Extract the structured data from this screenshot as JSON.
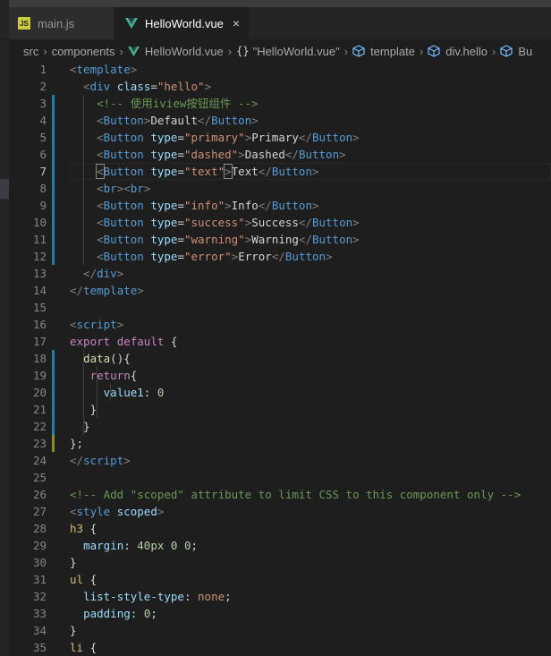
{
  "tabs": [
    {
      "label": "main.js",
      "icon": "js-file-icon",
      "active": false
    },
    {
      "label": "HelloWorld.vue",
      "icon": "vue-file-icon",
      "active": true,
      "close": "×"
    }
  ],
  "breadcrumb": {
    "items": [
      "src",
      "components",
      "HelloWorld.vue",
      "\"HelloWorld.vue\"",
      "template",
      "div.hello",
      "Bu"
    ]
  },
  "editor": {
    "current_line": 7,
    "lines": [
      {
        "n": "1",
        "tokens": [
          [
            "t-punct",
            "<"
          ],
          [
            "t-tag",
            "template"
          ],
          [
            "t-punct",
            ">"
          ]
        ]
      },
      {
        "n": "2",
        "tokens": [
          [
            "t-plain",
            "  "
          ],
          [
            "t-punct",
            "<"
          ],
          [
            "t-tag",
            "div"
          ],
          [
            "t-plain",
            " "
          ],
          [
            "t-attr",
            "class"
          ],
          [
            "t-plain",
            "="
          ],
          [
            "t-str",
            "\"hello\""
          ],
          [
            "t-punct",
            ">"
          ]
        ]
      },
      {
        "n": "3",
        "tokens": [
          [
            "t-plain",
            "    "
          ],
          [
            "t-com",
            "<!-- 使用iview按钮组件 -->"
          ]
        ]
      },
      {
        "n": "4",
        "tokens": [
          [
            "t-plain",
            "    "
          ],
          [
            "t-punct",
            "<"
          ],
          [
            "t-tag",
            "Button"
          ],
          [
            "t-punct",
            ">"
          ],
          [
            "t-text",
            "Default"
          ],
          [
            "t-punct",
            "</"
          ],
          [
            "t-tag",
            "Button"
          ],
          [
            "t-punct",
            ">"
          ]
        ]
      },
      {
        "n": "5",
        "tokens": [
          [
            "t-plain",
            "    "
          ],
          [
            "t-punct",
            "<"
          ],
          [
            "t-tag",
            "Button"
          ],
          [
            "t-plain",
            " "
          ],
          [
            "t-attr",
            "type"
          ],
          [
            "t-plain",
            "="
          ],
          [
            "t-str",
            "\"primary\""
          ],
          [
            "t-punct",
            ">"
          ],
          [
            "t-text",
            "Primary"
          ],
          [
            "t-punct",
            "</"
          ],
          [
            "t-tag",
            "Button"
          ],
          [
            "t-punct",
            ">"
          ]
        ]
      },
      {
        "n": "6",
        "tokens": [
          [
            "t-plain",
            "    "
          ],
          [
            "t-punct",
            "<"
          ],
          [
            "t-tag",
            "Button"
          ],
          [
            "t-plain",
            " "
          ],
          [
            "t-attr",
            "type"
          ],
          [
            "t-plain",
            "="
          ],
          [
            "t-str",
            "\"dashed\""
          ],
          [
            "t-punct",
            ">"
          ],
          [
            "t-text",
            "Dashed"
          ],
          [
            "t-punct",
            "</"
          ],
          [
            "t-tag",
            "Button"
          ],
          [
            "t-punct",
            ">"
          ]
        ]
      },
      {
        "n": "7",
        "tokens": [
          [
            "t-plain",
            "    "
          ],
          [
            "t-punct bracket-hl",
            "<"
          ],
          [
            "t-tag",
            "Button"
          ],
          [
            "t-plain",
            " "
          ],
          [
            "t-attr",
            "type"
          ],
          [
            "t-plain",
            "="
          ],
          [
            "t-str",
            "\"text\""
          ],
          [
            "t-punct bracket-hl",
            ">"
          ],
          [
            "t-text",
            "Text"
          ],
          [
            "t-punct",
            "</"
          ],
          [
            "t-tag",
            "Button"
          ],
          [
            "t-punct",
            ">"
          ]
        ]
      },
      {
        "n": "8",
        "tokens": [
          [
            "t-plain",
            "    "
          ],
          [
            "t-punct",
            "<"
          ],
          [
            "t-tag",
            "br"
          ],
          [
            "t-punct",
            "><"
          ],
          [
            "t-tag",
            "br"
          ],
          [
            "t-punct",
            ">"
          ]
        ]
      },
      {
        "n": "9",
        "tokens": [
          [
            "t-plain",
            "    "
          ],
          [
            "t-punct",
            "<"
          ],
          [
            "t-tag",
            "Button"
          ],
          [
            "t-plain",
            " "
          ],
          [
            "t-attr",
            "type"
          ],
          [
            "t-plain",
            "="
          ],
          [
            "t-str",
            "\"info\""
          ],
          [
            "t-punct",
            ">"
          ],
          [
            "t-text",
            "Info"
          ],
          [
            "t-punct",
            "</"
          ],
          [
            "t-tag",
            "Button"
          ],
          [
            "t-punct",
            ">"
          ]
        ]
      },
      {
        "n": "10",
        "tokens": [
          [
            "t-plain",
            "    "
          ],
          [
            "t-punct",
            "<"
          ],
          [
            "t-tag",
            "Button"
          ],
          [
            "t-plain",
            " "
          ],
          [
            "t-attr",
            "type"
          ],
          [
            "t-plain",
            "="
          ],
          [
            "t-str",
            "\"success\""
          ],
          [
            "t-punct",
            ">"
          ],
          [
            "t-text",
            "Success"
          ],
          [
            "t-punct",
            "</"
          ],
          [
            "t-tag",
            "Button"
          ],
          [
            "t-punct",
            ">"
          ]
        ]
      },
      {
        "n": "11",
        "tokens": [
          [
            "t-plain",
            "    "
          ],
          [
            "t-punct",
            "<"
          ],
          [
            "t-tag",
            "Button"
          ],
          [
            "t-plain",
            " "
          ],
          [
            "t-attr",
            "type"
          ],
          [
            "t-plain",
            "="
          ],
          [
            "t-str",
            "\"warning\""
          ],
          [
            "t-punct",
            ">"
          ],
          [
            "t-text",
            "Warning"
          ],
          [
            "t-punct",
            "</"
          ],
          [
            "t-tag",
            "Button"
          ],
          [
            "t-punct",
            ">"
          ]
        ]
      },
      {
        "n": "12",
        "tokens": [
          [
            "t-plain",
            "    "
          ],
          [
            "t-punct",
            "<"
          ],
          [
            "t-tag",
            "Button"
          ],
          [
            "t-plain",
            " "
          ],
          [
            "t-attr",
            "type"
          ],
          [
            "t-plain",
            "="
          ],
          [
            "t-str",
            "\"error\""
          ],
          [
            "t-punct",
            ">"
          ],
          [
            "t-text",
            "Error"
          ],
          [
            "t-punct",
            "</"
          ],
          [
            "t-tag",
            "Button"
          ],
          [
            "t-punct",
            ">"
          ]
        ]
      },
      {
        "n": "13",
        "tokens": [
          [
            "t-plain",
            "  "
          ],
          [
            "t-punct",
            "</"
          ],
          [
            "t-tag",
            "div"
          ],
          [
            "t-punct",
            ">"
          ]
        ]
      },
      {
        "n": "14",
        "tokens": [
          [
            "t-punct",
            "</"
          ],
          [
            "t-tag",
            "template"
          ],
          [
            "t-punct",
            ">"
          ]
        ]
      },
      {
        "n": "15",
        "tokens": []
      },
      {
        "n": "16",
        "tokens": [
          [
            "t-punct",
            "<"
          ],
          [
            "t-tag",
            "script"
          ],
          [
            "t-punct",
            ">"
          ]
        ]
      },
      {
        "n": "17",
        "tokens": [
          [
            "t-kw",
            "export"
          ],
          [
            "t-plain",
            " "
          ],
          [
            "t-kw",
            "default"
          ],
          [
            "t-plain",
            " {"
          ]
        ]
      },
      {
        "n": "18",
        "tokens": [
          [
            "t-plain",
            "  "
          ],
          [
            "t-fn",
            "data"
          ],
          [
            "t-plain",
            "(){"
          ]
        ]
      },
      {
        "n": "19",
        "tokens": [
          [
            "t-plain",
            "   "
          ],
          [
            "t-kw",
            "return"
          ],
          [
            "t-plain",
            "{"
          ]
        ]
      },
      {
        "n": "20",
        "tokens": [
          [
            "t-plain",
            "     "
          ],
          [
            "t-attr",
            "value1"
          ],
          [
            "t-plain",
            ": "
          ],
          [
            "t-num",
            "0"
          ]
        ]
      },
      {
        "n": "21",
        "tokens": [
          [
            "t-plain",
            "   }"
          ]
        ]
      },
      {
        "n": "22",
        "tokens": [
          [
            "t-plain",
            "  }"
          ]
        ]
      },
      {
        "n": "23",
        "tokens": [
          [
            "t-plain",
            "};"
          ]
        ]
      },
      {
        "n": "24",
        "tokens": [
          [
            "t-punct",
            "</"
          ],
          [
            "t-tag",
            "script"
          ],
          [
            "t-punct",
            ">"
          ]
        ]
      },
      {
        "n": "25",
        "tokens": []
      },
      {
        "n": "26",
        "tokens": [
          [
            "t-com",
            "<!-- Add \"scoped\" attribute to limit CSS to this component only -->"
          ]
        ]
      },
      {
        "n": "27",
        "tokens": [
          [
            "t-punct",
            "<"
          ],
          [
            "t-tag",
            "style"
          ],
          [
            "t-plain",
            " "
          ],
          [
            "t-attr",
            "scoped"
          ],
          [
            "t-punct",
            ">"
          ]
        ]
      },
      {
        "n": "28",
        "tokens": [
          [
            "t-sel",
            "h3"
          ],
          [
            "t-plain",
            " {"
          ]
        ]
      },
      {
        "n": "29",
        "tokens": [
          [
            "t-plain",
            "  "
          ],
          [
            "t-prop",
            "margin"
          ],
          [
            "t-plain",
            ": "
          ],
          [
            "t-num",
            "40px"
          ],
          [
            "t-plain",
            " "
          ],
          [
            "t-num",
            "0"
          ],
          [
            "t-plain",
            " "
          ],
          [
            "t-num",
            "0"
          ],
          [
            "t-plain",
            ";"
          ]
        ]
      },
      {
        "n": "30",
        "tokens": [
          [
            "t-plain",
            "}"
          ]
        ]
      },
      {
        "n": "31",
        "tokens": [
          [
            "t-sel",
            "ul"
          ],
          [
            "t-plain",
            " {"
          ]
        ]
      },
      {
        "n": "32",
        "tokens": [
          [
            "t-plain",
            "  "
          ],
          [
            "t-prop",
            "list-style-type"
          ],
          [
            "t-plain",
            ": "
          ],
          [
            "t-val",
            "none"
          ],
          [
            "t-plain",
            ";"
          ]
        ]
      },
      {
        "n": "33",
        "tokens": [
          [
            "t-plain",
            "  "
          ],
          [
            "t-prop",
            "padding"
          ],
          [
            "t-plain",
            ": "
          ],
          [
            "t-num",
            "0"
          ],
          [
            "t-plain",
            ";"
          ]
        ]
      },
      {
        "n": "34",
        "tokens": [
          [
            "t-plain",
            "}"
          ]
        ]
      },
      {
        "n": "35",
        "tokens": [
          [
            "t-sel",
            "li"
          ],
          [
            "t-plain",
            " {"
          ]
        ]
      }
    ],
    "modified_lines_blue": [
      3,
      4,
      5,
      6,
      7,
      8,
      9,
      10,
      11,
      12,
      18,
      19,
      20,
      21,
      22
    ],
    "modified_lines_yellow": [
      23
    ]
  }
}
